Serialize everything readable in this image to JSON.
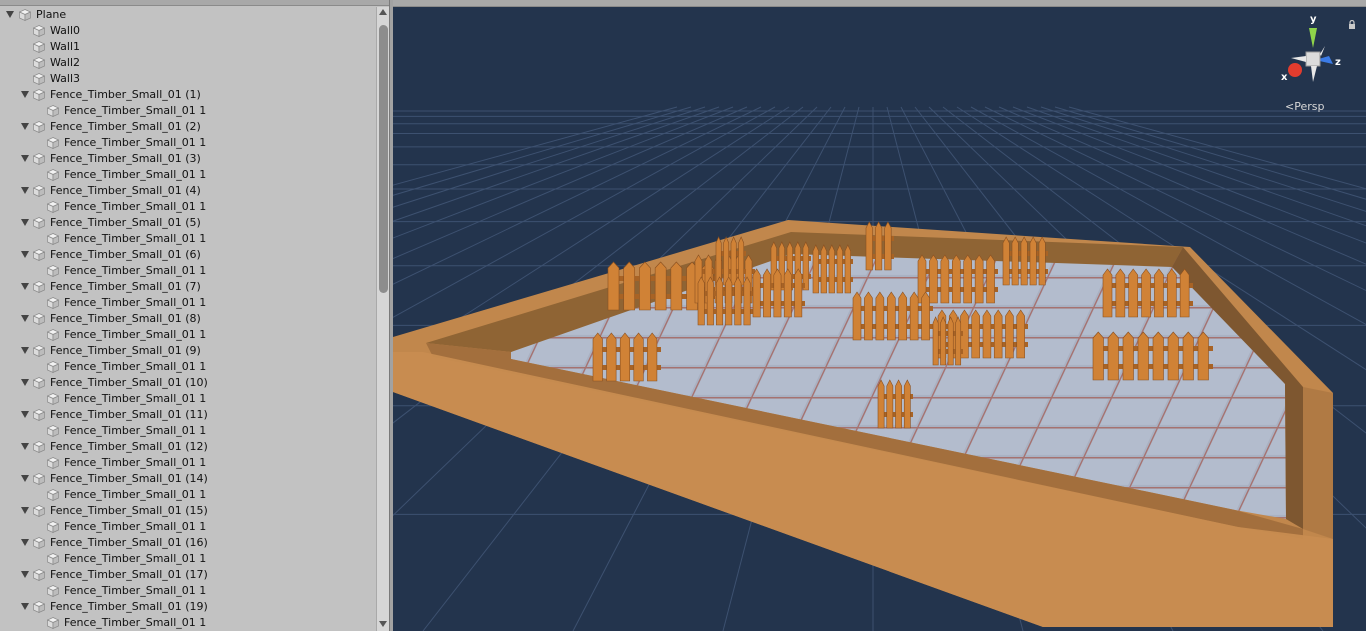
{
  "hierarchy": {
    "rows": [
      {
        "label": "Plane",
        "depth": 0,
        "expanded": true
      },
      {
        "label": "Wall0",
        "depth": 1,
        "expanded": null
      },
      {
        "label": "Wall1",
        "depth": 1,
        "expanded": null
      },
      {
        "label": "Wall2",
        "depth": 1,
        "expanded": null
      },
      {
        "label": "Wall3",
        "depth": 1,
        "expanded": null
      },
      {
        "label": "Fence_Timber_Small_01 (1)",
        "depth": 1,
        "expanded": true
      },
      {
        "label": "Fence_Timber_Small_01 1",
        "depth": 2,
        "expanded": null
      },
      {
        "label": "Fence_Timber_Small_01 (2)",
        "depth": 1,
        "expanded": true
      },
      {
        "label": "Fence_Timber_Small_01 1",
        "depth": 2,
        "expanded": null
      },
      {
        "label": "Fence_Timber_Small_01 (3)",
        "depth": 1,
        "expanded": true
      },
      {
        "label": "Fence_Timber_Small_01 1",
        "depth": 2,
        "expanded": null
      },
      {
        "label": "Fence_Timber_Small_01 (4)",
        "depth": 1,
        "expanded": true
      },
      {
        "label": "Fence_Timber_Small_01 1",
        "depth": 2,
        "expanded": null
      },
      {
        "label": "Fence_Timber_Small_01 (5)",
        "depth": 1,
        "expanded": true
      },
      {
        "label": "Fence_Timber_Small_01 1",
        "depth": 2,
        "expanded": null
      },
      {
        "label": "Fence_Timber_Small_01 (6)",
        "depth": 1,
        "expanded": true
      },
      {
        "label": "Fence_Timber_Small_01 1",
        "depth": 2,
        "expanded": null
      },
      {
        "label": "Fence_Timber_Small_01 (7)",
        "depth": 1,
        "expanded": true
      },
      {
        "label": "Fence_Timber_Small_01 1",
        "depth": 2,
        "expanded": null
      },
      {
        "label": "Fence_Timber_Small_01 (8)",
        "depth": 1,
        "expanded": true
      },
      {
        "label": "Fence_Timber_Small_01 1",
        "depth": 2,
        "expanded": null
      },
      {
        "label": "Fence_Timber_Small_01 (9)",
        "depth": 1,
        "expanded": true
      },
      {
        "label": "Fence_Timber_Small_01 1",
        "depth": 2,
        "expanded": null
      },
      {
        "label": "Fence_Timber_Small_01 (10)",
        "depth": 1,
        "expanded": true
      },
      {
        "label": "Fence_Timber_Small_01 1",
        "depth": 2,
        "expanded": null
      },
      {
        "label": "Fence_Timber_Small_01 (11)",
        "depth": 1,
        "expanded": true
      },
      {
        "label": "Fence_Timber_Small_01 1",
        "depth": 2,
        "expanded": null
      },
      {
        "label": "Fence_Timber_Small_01 (12)",
        "depth": 1,
        "expanded": true
      },
      {
        "label": "Fence_Timber_Small_01 1",
        "depth": 2,
        "expanded": null
      },
      {
        "label": "Fence_Timber_Small_01 (14)",
        "depth": 1,
        "expanded": true
      },
      {
        "label": "Fence_Timber_Small_01 1",
        "depth": 2,
        "expanded": null
      },
      {
        "label": "Fence_Timber_Small_01 (15)",
        "depth": 1,
        "expanded": true
      },
      {
        "label": "Fence_Timber_Small_01 1",
        "depth": 2,
        "expanded": null
      },
      {
        "label": "Fence_Timber_Small_01 (16)",
        "depth": 1,
        "expanded": true
      },
      {
        "label": "Fence_Timber_Small_01 1",
        "depth": 2,
        "expanded": null
      },
      {
        "label": "Fence_Timber_Small_01 (17)",
        "depth": 1,
        "expanded": true
      },
      {
        "label": "Fence_Timber_Small_01 1",
        "depth": 2,
        "expanded": null
      },
      {
        "label": "Fence_Timber_Small_01 (19)",
        "depth": 1,
        "expanded": true
      },
      {
        "label": "Fence_Timber_Small_01 1",
        "depth": 2,
        "expanded": null
      }
    ]
  },
  "scene": {
    "projection_label": "Persp",
    "axis_labels": {
      "x": "x",
      "y": "y",
      "z": "z"
    },
    "colors": {
      "background": "#23344d",
      "grid": "#3d5170",
      "wall_top": "#c1874c",
      "wall_inner": "#8f6434",
      "floor": "#9aa4b8",
      "fence": "#d08236",
      "axis_x": "#e23c2e",
      "axis_y": "#8fd44a",
      "axis_z": "#3b7be6"
    }
  },
  "icons": {
    "fold": "triangle-down-icon",
    "gameobject": "cube-icon",
    "lock": "lock-icon"
  }
}
